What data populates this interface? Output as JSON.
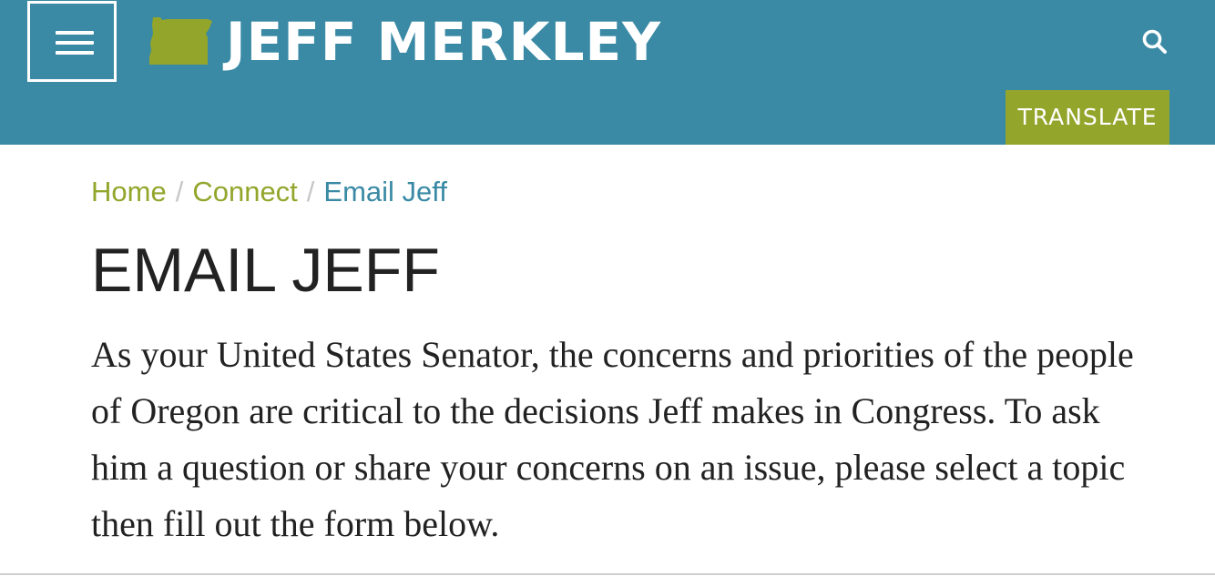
{
  "header": {
    "menu_label": "Menu",
    "logo_text": "JEFF MERKLEY",
    "translate_label": "TRANSLATE",
    "search_icon": "search-icon",
    "menu_icon": "hamburger-menu-icon",
    "logo_icon": "oregon-state-icon"
  },
  "breadcrumb": {
    "items": [
      {
        "label": "Home"
      },
      {
        "label": "Connect"
      },
      {
        "label": "Email Jeff"
      }
    ],
    "separator": "/"
  },
  "main": {
    "title": "EMAIL JEFF",
    "intro": "As your United States Senator, the concerns and priorities of the people of Oregon are critical to the decisions Jeff makes in Congress. To ask him a question or share your concerns on an issue, please select a topic then fill out the form below."
  },
  "colors": {
    "header_bg": "#3a8aa5",
    "accent_green": "#93a52b",
    "text_dark": "#222222"
  }
}
